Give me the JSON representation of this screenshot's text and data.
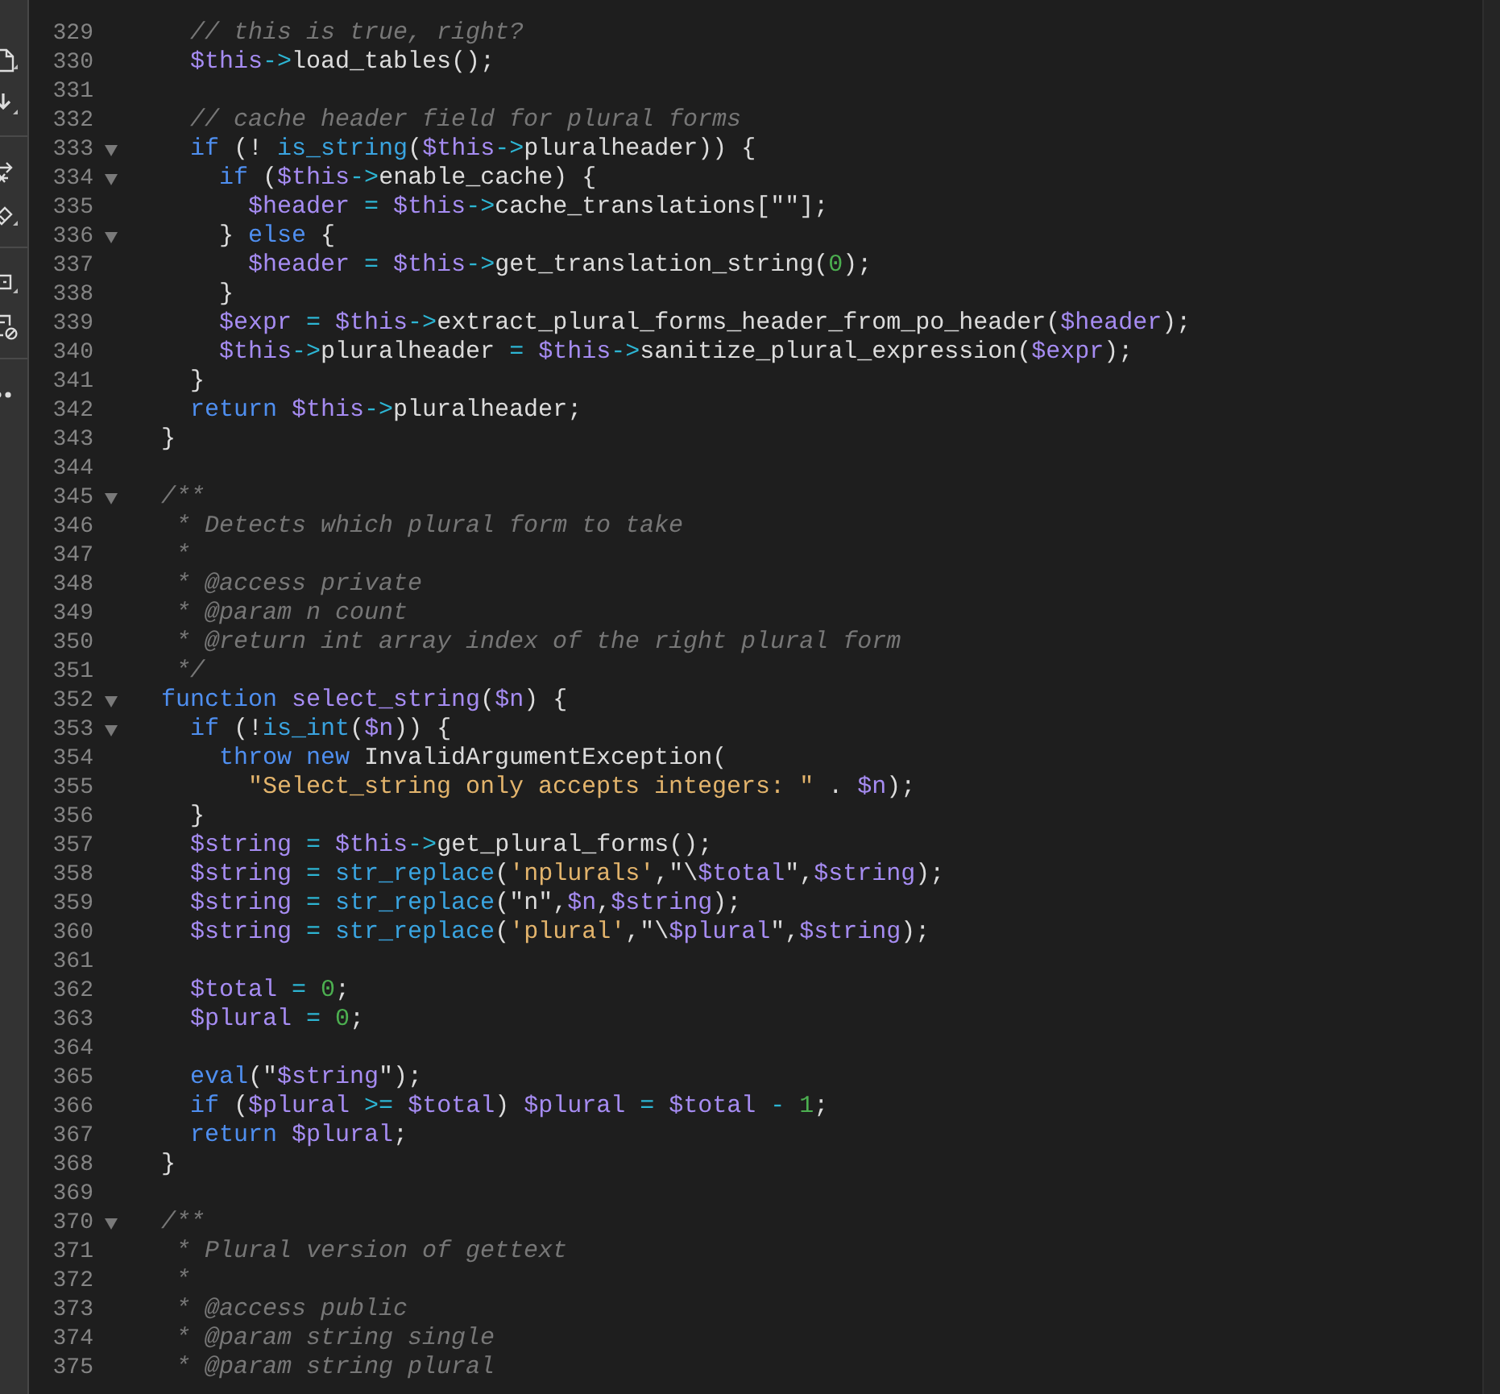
{
  "toolbar": {
    "buttons": [
      {
        "kind": "document"
      },
      {
        "kind": "download"
      },
      {
        "kind": "arrow"
      },
      {
        "kind": "tag"
      },
      {
        "kind": "comment"
      },
      {
        "kind": "document-blocked"
      },
      {
        "kind": "more"
      }
    ]
  },
  "lines": [
    {
      "number": "329",
      "foldable": false,
      "tokens": [
        {
          "kind": "comment",
          "text": "  // this is true, right?"
        }
      ]
    },
    {
      "number": "330",
      "foldable": false,
      "tokens": [
        {
          "kind": "variable",
          "text": "  $this"
        },
        {
          "kind": "operator",
          "text": "->"
        },
        {
          "kind": "plain",
          "text": "load_tables();"
        }
      ]
    },
    {
      "number": "331",
      "foldable": false
    },
    {
      "number": "332",
      "foldable": false,
      "tokens": [
        {
          "kind": "comment",
          "text": "  // cache header field for plural forms"
        }
      ]
    },
    {
      "number": "333",
      "foldable": true,
      "tokens": [
        {
          "kind": "keyword",
          "text": "  if"
        },
        {
          "kind": "plain",
          "text": " (! "
        },
        {
          "kind": "builtin",
          "text": "is_string"
        },
        {
          "kind": "plain",
          "text": "("
        },
        {
          "kind": "variable",
          "text": "$this"
        },
        {
          "kind": "operator",
          "text": "->"
        },
        {
          "kind": "plain",
          "text": "pluralheader)) {"
        }
      ]
    },
    {
      "number": "334",
      "foldable": true,
      "tokens": [
        {
          "kind": "keyword",
          "text": "    if"
        },
        {
          "kind": "plain",
          "text": " ("
        },
        {
          "kind": "variable",
          "text": "$this"
        },
        {
          "kind": "operator",
          "text": "->"
        },
        {
          "kind": "plain",
          "text": "enable_cache) {"
        }
      ]
    },
    {
      "number": "335",
      "foldable": false,
      "tokens": [
        {
          "kind": "variable",
          "text": "      $header"
        },
        {
          "kind": "operator",
          "text": " = "
        },
        {
          "kind": "variable",
          "text": "$this"
        },
        {
          "kind": "operator",
          "text": "->"
        },
        {
          "kind": "plain",
          "text": "cache_translations[\"\"];"
        }
      ]
    },
    {
      "number": "336",
      "foldable": true,
      "tokens": [
        {
          "kind": "plain",
          "text": "    } "
        },
        {
          "kind": "keyword",
          "text": "else"
        },
        {
          "kind": "plain",
          "text": " {"
        }
      ]
    },
    {
      "number": "337",
      "foldable": false,
      "tokens": [
        {
          "kind": "variable",
          "text": "      $header"
        },
        {
          "kind": "operator",
          "text": " = "
        },
        {
          "kind": "variable",
          "text": "$this"
        },
        {
          "kind": "operator",
          "text": "->"
        },
        {
          "kind": "plain",
          "text": "get_translation_string("
        },
        {
          "kind": "number",
          "text": "0"
        },
        {
          "kind": "plain",
          "text": ");"
        }
      ]
    },
    {
      "number": "338",
      "foldable": false,
      "tokens": [
        {
          "kind": "plain",
          "text": "    }"
        }
      ]
    },
    {
      "number": "339",
      "foldable": false,
      "tokens": [
        {
          "kind": "variable",
          "text": "    $expr"
        },
        {
          "kind": "operator",
          "text": " = "
        },
        {
          "kind": "variable",
          "text": "$this"
        },
        {
          "kind": "operator",
          "text": "->"
        },
        {
          "kind": "plain",
          "text": "extract_plural_forms_header_from_po_header("
        },
        {
          "kind": "variable",
          "text": "$header"
        },
        {
          "kind": "plain",
          "text": ");"
        }
      ]
    },
    {
      "number": "340",
      "foldable": false,
      "tokens": [
        {
          "kind": "variable",
          "text": "    $this"
        },
        {
          "kind": "operator",
          "text": "->"
        },
        {
          "kind": "plain",
          "text": "pluralheader"
        },
        {
          "kind": "operator",
          "text": " = "
        },
        {
          "kind": "variable",
          "text": "$this"
        },
        {
          "kind": "operator",
          "text": "->"
        },
        {
          "kind": "plain",
          "text": "sanitize_plural_expression("
        },
        {
          "kind": "variable",
          "text": "$expr"
        },
        {
          "kind": "plain",
          "text": ");"
        }
      ]
    },
    {
      "number": "341",
      "foldable": false,
      "tokens": [
        {
          "kind": "plain",
          "text": "  }"
        }
      ]
    },
    {
      "number": "342",
      "foldable": false,
      "tokens": [
        {
          "kind": "keyword",
          "text": "  return "
        },
        {
          "kind": "variable",
          "text": "$this"
        },
        {
          "kind": "operator",
          "text": "->"
        },
        {
          "kind": "plain",
          "text": "pluralheader;"
        }
      ]
    },
    {
      "number": "343",
      "foldable": false,
      "tokens": [
        {
          "kind": "plain",
          "text": "}"
        }
      ]
    },
    {
      "number": "344",
      "foldable": false
    },
    {
      "number": "345",
      "foldable": true,
      "tokens": [
        {
          "kind": "comment",
          "text": "/**"
        }
      ]
    },
    {
      "number": "346",
      "foldable": false,
      "tokens": [
        {
          "kind": "comment",
          "text": " * Detects which plural form to take"
        }
      ]
    },
    {
      "number": "347",
      "foldable": false,
      "tokens": [
        {
          "kind": "comment",
          "text": " *"
        }
      ]
    },
    {
      "number": "348",
      "foldable": false,
      "tokens": [
        {
          "kind": "comment",
          "text": " * @access private"
        }
      ]
    },
    {
      "number": "349",
      "foldable": false,
      "tokens": [
        {
          "kind": "comment",
          "text": " * @param n count"
        }
      ]
    },
    {
      "number": "350",
      "foldable": false,
      "tokens": [
        {
          "kind": "comment",
          "text": " * @return int array index of the right plural form"
        }
      ]
    },
    {
      "number": "351",
      "foldable": false,
      "tokens": [
        {
          "kind": "comment",
          "text": " */"
        }
      ]
    },
    {
      "number": "352",
      "foldable": true,
      "tokens": [
        {
          "kind": "keyword",
          "text": "function "
        },
        {
          "kind": "function",
          "text": "select_string"
        },
        {
          "kind": "plain",
          "text": "("
        },
        {
          "kind": "variable",
          "text": "$n"
        },
        {
          "kind": "plain",
          "text": ") {"
        }
      ]
    },
    {
      "number": "353",
      "foldable": true,
      "tokens": [
        {
          "kind": "keyword",
          "text": "  if"
        },
        {
          "kind": "plain",
          "text": " (!"
        },
        {
          "kind": "builtin",
          "text": "is_int"
        },
        {
          "kind": "plain",
          "text": "("
        },
        {
          "kind": "variable",
          "text": "$n"
        },
        {
          "kind": "plain",
          "text": ")) {"
        }
      ]
    },
    {
      "number": "354",
      "foldable": false,
      "tokens": [
        {
          "kind": "keyword",
          "text": "    throw new"
        },
        {
          "kind": "plain",
          "text": " InvalidArgumentException("
        }
      ]
    },
    {
      "number": "355",
      "foldable": false,
      "tokens": [
        {
          "kind": "string",
          "text": "      \"Select_string only accepts integers: \""
        },
        {
          "kind": "plain",
          "text": " . "
        },
        {
          "kind": "variable",
          "text": "$n"
        },
        {
          "kind": "plain",
          "text": ");"
        }
      ]
    },
    {
      "number": "356",
      "foldable": false,
      "tokens": [
        {
          "kind": "plain",
          "text": "  }"
        }
      ]
    },
    {
      "number": "357",
      "foldable": false,
      "tokens": [
        {
          "kind": "variable",
          "text": "  $string"
        },
        {
          "kind": "operator",
          "text": " = "
        },
        {
          "kind": "variable",
          "text": "$this"
        },
        {
          "kind": "operator",
          "text": "->"
        },
        {
          "kind": "plain",
          "text": "get_plural_forms();"
        }
      ]
    },
    {
      "number": "358",
      "foldable": false,
      "tokens": [
        {
          "kind": "variable",
          "text": "  $string"
        },
        {
          "kind": "operator",
          "text": " = "
        },
        {
          "kind": "builtin",
          "text": "str_replace"
        },
        {
          "kind": "plain",
          "text": "("
        },
        {
          "kind": "string",
          "text": "'nplurals'"
        },
        {
          "kind": "plain",
          "text": ",\"\\"
        },
        {
          "kind": "variable",
          "text": "$total"
        },
        {
          "kind": "plain",
          "text": "\","
        },
        {
          "kind": "variable",
          "text": "$string"
        },
        {
          "kind": "plain",
          "text": ");"
        }
      ]
    },
    {
      "number": "359",
      "foldable": false,
      "tokens": [
        {
          "kind": "variable",
          "text": "  $string"
        },
        {
          "kind": "operator",
          "text": " = "
        },
        {
          "kind": "builtin",
          "text": "str_replace"
        },
        {
          "kind": "plain",
          "text": "(\"n\","
        },
        {
          "kind": "variable",
          "text": "$n"
        },
        {
          "kind": "plain",
          "text": ","
        },
        {
          "kind": "variable",
          "text": "$string"
        },
        {
          "kind": "plain",
          "text": ");"
        }
      ]
    },
    {
      "number": "360",
      "foldable": false,
      "tokens": [
        {
          "kind": "variable",
          "text": "  $string"
        },
        {
          "kind": "operator",
          "text": " = "
        },
        {
          "kind": "builtin",
          "text": "str_replace"
        },
        {
          "kind": "plain",
          "text": "("
        },
        {
          "kind": "string",
          "text": "'plural'"
        },
        {
          "kind": "plain",
          "text": ",\"\\"
        },
        {
          "kind": "variable",
          "text": "$plural"
        },
        {
          "kind": "plain",
          "text": "\","
        },
        {
          "kind": "variable",
          "text": "$string"
        },
        {
          "kind": "plain",
          "text": ");"
        }
      ]
    },
    {
      "number": "361",
      "foldable": false
    },
    {
      "number": "362",
      "foldable": false,
      "tokens": [
        {
          "kind": "variable",
          "text": "  $total"
        },
        {
          "kind": "operator",
          "text": " = "
        },
        {
          "kind": "number",
          "text": "0"
        },
        {
          "kind": "plain",
          "text": ";"
        }
      ]
    },
    {
      "number": "363",
      "foldable": false,
      "tokens": [
        {
          "kind": "variable",
          "text": "  $plural"
        },
        {
          "kind": "operator",
          "text": " = "
        },
        {
          "kind": "number",
          "text": "0"
        },
        {
          "kind": "plain",
          "text": ";"
        }
      ]
    },
    {
      "number": "364",
      "foldable": false
    },
    {
      "number": "365",
      "foldable": false,
      "tokens": [
        {
          "kind": "keyword",
          "text": "  eval"
        },
        {
          "kind": "plain",
          "text": "(\""
        },
        {
          "kind": "variable",
          "text": "$string"
        },
        {
          "kind": "plain",
          "text": "\");"
        }
      ]
    },
    {
      "number": "366",
      "foldable": false,
      "tokens": [
        {
          "kind": "keyword",
          "text": "  if"
        },
        {
          "kind": "plain",
          "text": " ("
        },
        {
          "kind": "variable",
          "text": "$plural"
        },
        {
          "kind": "operator",
          "text": " >= "
        },
        {
          "kind": "variable",
          "text": "$total"
        },
        {
          "kind": "plain",
          "text": ") "
        },
        {
          "kind": "variable",
          "text": "$plural"
        },
        {
          "kind": "operator",
          "text": " = "
        },
        {
          "kind": "variable",
          "text": "$total"
        },
        {
          "kind": "operator",
          "text": " - "
        },
        {
          "kind": "number",
          "text": "1"
        },
        {
          "kind": "plain",
          "text": ";"
        }
      ]
    },
    {
      "number": "367",
      "foldable": false,
      "tokens": [
        {
          "kind": "keyword",
          "text": "  return "
        },
        {
          "kind": "variable",
          "text": "$plural"
        },
        {
          "kind": "plain",
          "text": ";"
        }
      ]
    },
    {
      "number": "368",
      "foldable": false,
      "tokens": [
        {
          "kind": "plain",
          "text": "}"
        }
      ]
    },
    {
      "number": "369",
      "foldable": false
    },
    {
      "number": "370",
      "foldable": true,
      "tokens": [
        {
          "kind": "comment",
          "text": "/**"
        }
      ]
    },
    {
      "number": "371",
      "foldable": false,
      "tokens": [
        {
          "kind": "comment",
          "text": " * Plural version of gettext"
        }
      ]
    },
    {
      "number": "372",
      "foldable": false,
      "tokens": [
        {
          "kind": "comment",
          "text": " *"
        }
      ]
    },
    {
      "number": "373",
      "foldable": false,
      "tokens": [
        {
          "kind": "comment",
          "text": " * @access public"
        }
      ]
    },
    {
      "number": "374",
      "foldable": false,
      "tokens": [
        {
          "kind": "comment",
          "text": " * @param string single"
        }
      ]
    },
    {
      "number": "375",
      "foldable": false,
      "tokens": [
        {
          "kind": "comment",
          "text": " * @param string plural"
        }
      ]
    }
  ]
}
